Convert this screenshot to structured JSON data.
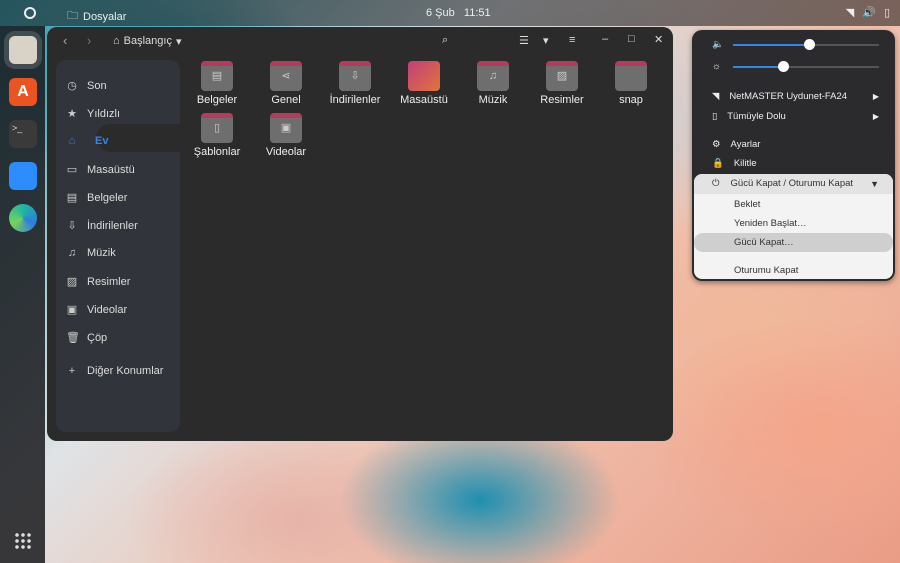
{
  "topbar": {
    "app_name": "Dosyalar",
    "date": "6 Şub",
    "time": "11:51"
  },
  "dock": {
    "apps": [
      "files",
      "app-center",
      "terminal",
      "zoom",
      "edge-dev"
    ]
  },
  "window": {
    "path": "Başlangıç",
    "sidebar": [
      {
        "label": "Son",
        "icon": "clock-icon"
      },
      {
        "label": "Yıldızlı",
        "icon": "star-icon"
      },
      {
        "label": "Ev",
        "icon": "home-icon"
      },
      {
        "label": "Masaüstü",
        "icon": "desktop-icon"
      },
      {
        "label": "Belgeler",
        "icon": "document-icon"
      },
      {
        "label": "İndirilenler",
        "icon": "download-icon"
      },
      {
        "label": "Müzik",
        "icon": "music-icon"
      },
      {
        "label": "Resimler",
        "icon": "image-icon"
      },
      {
        "label": "Videolar",
        "icon": "video-icon"
      },
      {
        "label": "Çöp",
        "icon": "trash-icon"
      },
      {
        "label": "Diğer Konumlar",
        "icon": "plus-icon"
      }
    ],
    "folders": [
      {
        "label": "Belgeler",
        "glyph": "▤"
      },
      {
        "label": "Genel",
        "glyph": "⋖"
      },
      {
        "label": "İndirilenler",
        "glyph": "⇩"
      },
      {
        "label": "Masaüstü",
        "glyph": ""
      },
      {
        "label": "Müzik",
        "glyph": "♫"
      },
      {
        "label": "Resimler",
        "glyph": "▨"
      },
      {
        "label": "snap",
        "glyph": ""
      },
      {
        "label": "Şablonlar",
        "glyph": "▯"
      },
      {
        "label": "Videolar",
        "glyph": "▣"
      }
    ]
  },
  "panel": {
    "volume": 0.52,
    "brightness": 0.34,
    "wifi": "NetMASTER Uydunet-FA24",
    "battery": "Tümüyle Dolu",
    "settings": "Ayarlar",
    "lock": "Kilitle",
    "power_header": "Gücü Kapat / Oturumu Kapat",
    "power_items": [
      "Beklet",
      "Yeniden Başlat…",
      "Gücü Kapat…",
      "Oturumu Kapat"
    ],
    "accent": "#3584e4"
  }
}
